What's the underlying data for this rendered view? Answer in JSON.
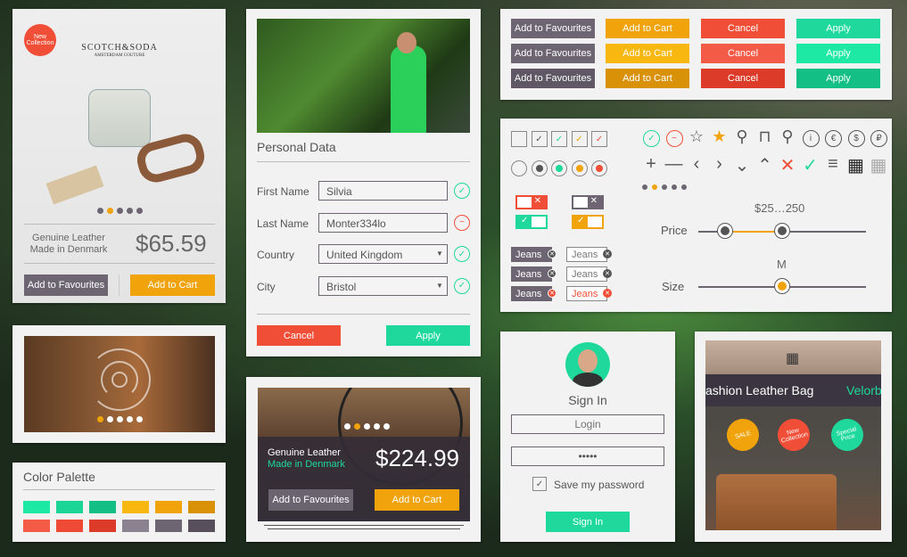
{
  "product": {
    "badge": "New Collection",
    "brand": "SCOTCH&SODA",
    "brand_sub": "AMSTERDAM COUTURE",
    "line1": "Genuine Leather",
    "line2": "Made in Denmark",
    "price": "$65.59",
    "fav": "Add to Favourites",
    "cart": "Add to Cart"
  },
  "palette": {
    "title": "Color Palette",
    "colors": [
      "#1de9a4",
      "#1bd597",
      "#14bf86",
      "#f8b810",
      "#f0a30a",
      "#d99208",
      "#f35b47",
      "#ef4a36",
      "#dc3b29",
      "#8a8290",
      "#6d6672",
      "#57505c"
    ]
  },
  "form": {
    "title": "Personal Data",
    "fields": [
      {
        "label": "First Name",
        "value": "Silvia",
        "status": "valid"
      },
      {
        "label": "Last Name",
        "value": "Monter334lo",
        "status": "invalid"
      },
      {
        "label": "Country",
        "value": "United Kingdom",
        "status": "valid"
      },
      {
        "label": "City",
        "value": "Bristol",
        "status": "valid"
      }
    ],
    "cancel": "Cancel",
    "apply": "Apply"
  },
  "bike": {
    "line1": "Genuine Leather",
    "line2": "Made in Denmark",
    "price": "$224.99",
    "fav": "Add to Favourites",
    "cart": "Add to Cart"
  },
  "buttons": {
    "fav": "Add to Favourites",
    "cart": "Add to Cart",
    "cancel": "Cancel",
    "apply": "Apply"
  },
  "controls": {
    "price_label": "Price",
    "price_range": "$25…250",
    "size_label": "Size",
    "size_value": "M",
    "tag": "Jeans",
    "icons": [
      "check-circle",
      "minus-circle",
      "star-outline",
      "star-filled",
      "search",
      "shopping-bag",
      "map-pin",
      "info",
      "euro",
      "dollar",
      "ruble"
    ],
    "icons2": [
      "plus",
      "minus",
      "chevron-left",
      "chevron-right",
      "chevron-down",
      "chevron-up",
      "close",
      "check",
      "menu",
      "grid-filled",
      "grid-outline"
    ]
  },
  "signin": {
    "title": "Sign In",
    "login_placeholder": "Login",
    "password": "•••••",
    "remember": "Save my password",
    "button": "Sign In"
  },
  "fashion": {
    "title": "ashion Leather Bag",
    "brand": "Velorb",
    "sale": "SALE",
    "new": "New Collection",
    "special": "Special Price"
  },
  "colors": {
    "grey": "#6d6672",
    "orange": "#f0a30a",
    "red": "#f04e37",
    "green": "#1ed99b"
  }
}
